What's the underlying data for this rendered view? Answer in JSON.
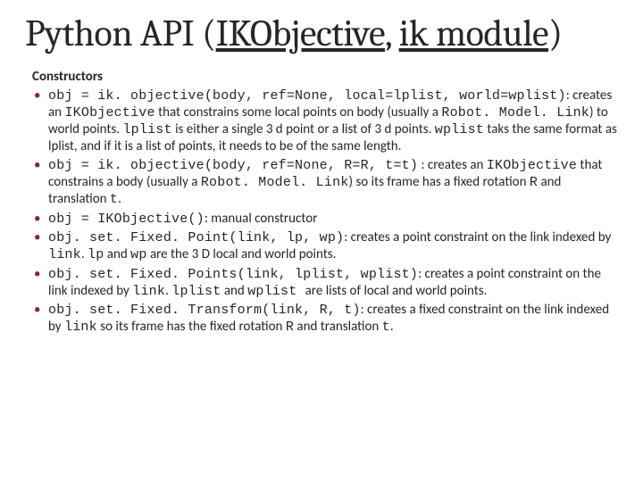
{
  "title": {
    "prefix": "Python API (",
    "link1": "IKObjective",
    "sep": ", ",
    "link2": "ik module",
    "suffix": ")"
  },
  "subhead": "Constructors",
  "items": [
    {
      "code1": "obj = ik. objective(body, ref=None, local=lplist, world=wplist)",
      "t1": ": creates an ",
      "code2": "IKObjective",
      "t2": " that constrains some local points on body (usually a ",
      "code3": "Robot. Model. Link",
      "t3": ") to world points. ",
      "code4": "lplist",
      "t4": " is either a single 3 d point or a list of 3 d points. ",
      "code5": "wplist",
      "t5": " taks the same format as lplist, and if it is a list of points, it needs to be of the same length."
    },
    {
      "code1": "obj = ik. objective(body, ref=None, R=R, t=t)",
      "t1": " : creates an ",
      "code2": "IKObjective",
      "t2": " that constrains a body (usually a ",
      "code3": "Robot. Model. Link",
      "t3": ") so its frame has a fixed rotation ",
      "code4": "R",
      "t4": " and translation ",
      "code5": "t",
      "t5": "."
    },
    {
      "code1": "obj = IKObjective()",
      "t1": ": manual constructor"
    },
    {
      "code1": "obj. set. Fixed. Point(link, lp, wp)",
      "t1": ": creates a point constraint on the link indexed by ",
      "code2": "link",
      "t2": ". ",
      "code3": "lp",
      "t3": " and ",
      "code4": "wp",
      "t4": " are the 3 D local and world points."
    },
    {
      "code1": "obj. set. Fixed. Points(link, lplist, wplist)",
      "t1": ": creates a point constraint on the link indexed by ",
      "code2": "link",
      "t2": ". ",
      "code3": "lplist",
      "t3": " and ",
      "code4": "wplist ",
      "t4": " are lists of local and world points."
    },
    {
      "code1": "obj. set. Fixed. Transform(link, R, t)",
      "t1": ": creates a fixed constraint on the link indexed by ",
      "code2": "link",
      "t2": " so its frame has the fixed rotation ",
      "code3": "R",
      "t3": " and translation ",
      "code4": "t",
      "t4": "."
    }
  ]
}
